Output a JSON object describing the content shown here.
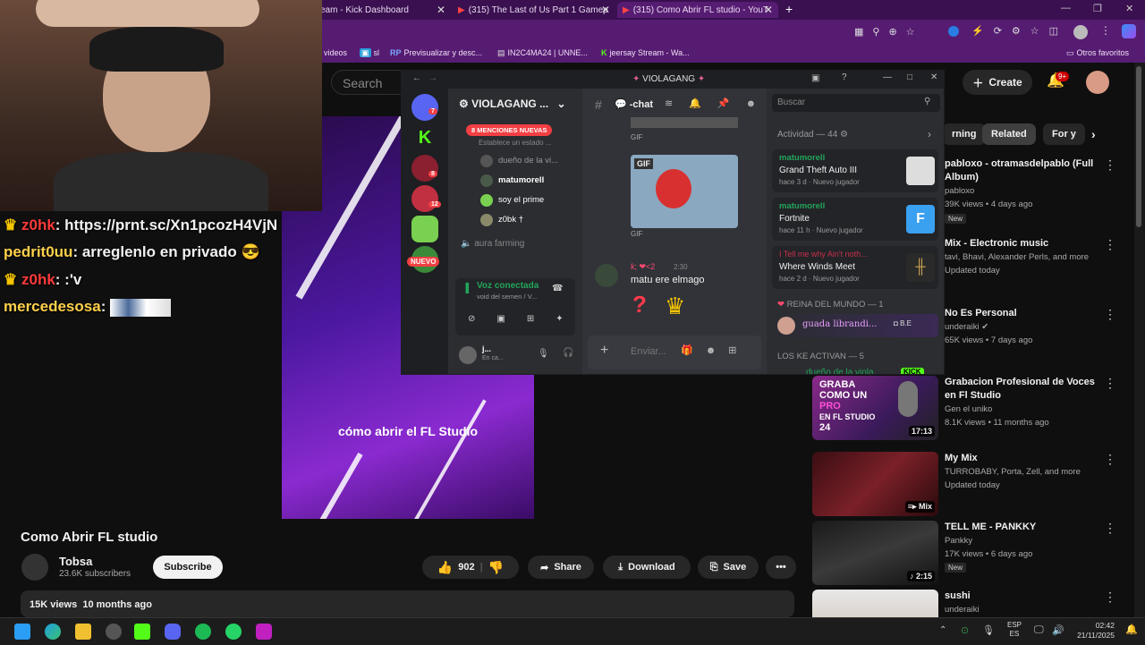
{
  "browser": {
    "tabs": [
      {
        "label": "eam - Kick Dashboard"
      },
      {
        "label": "(315) The Last of Us Part 1 Gamep"
      },
      {
        "label": "(315) Como Abrir FL studio - YouT"
      }
    ],
    "bookmarks": [
      "videos",
      "sl",
      "Previsualizar y desc...",
      "IN2C4MA24 | UNNE...",
      "jeersay Stream - Wa..."
    ],
    "bookmarks_other": "Otros favoritos"
  },
  "stream_chat": [
    {
      "user": "z0hk",
      "text": "https://prnt.sc/Xn1pcozH4VjN",
      "crown": true
    },
    {
      "user": "pedrit0uu",
      "text": "arreglenlo en privado",
      "crown": false
    },
    {
      "user": "z0hk",
      "text": ":'v",
      "crown": true
    },
    {
      "user": "mercedesosa",
      "text": "",
      "crown": false
    }
  ],
  "youtube": {
    "search_placeholder": "Search",
    "create_label": "Create",
    "notif_count": "9+",
    "video_caption": "cómo abrir el FL Studio",
    "video_title": "Como Abrir FL studio",
    "channel_name": "Tobsa",
    "subscribers": "23.6K subscribers",
    "subscribe_label": "Subscribe",
    "likes": "902",
    "share_label": "Share",
    "download_label": "Download",
    "save_label": "Save",
    "more_label": "•••",
    "views": "15K views",
    "age": "10 months ago",
    "chips": [
      "rning",
      "Related",
      "For y"
    ],
    "recommendations": [
      {
        "title": "pabloxo - otramasdelpablo (Full Album)",
        "channel": "pabloxo",
        "meta": "39K views • 4 days ago",
        "badge": "New",
        "duration": ""
      },
      {
        "title": "Mix - Electronic music",
        "channel": "tavi, Bhavi, Alexander Perls, and more",
        "meta": "Updated today",
        "badge": "",
        "duration": ""
      },
      {
        "title": "No Es Personal",
        "channel": "underaiki",
        "meta": "65K views • 7 days ago",
        "badge": "",
        "duration": ""
      },
      {
        "title": "Grabacion Profesional de Voces en Fl Studio",
        "channel": "Gen el uniko",
        "meta": "8.1K views • 11 months ago",
        "badge": "",
        "duration": "17:13"
      },
      {
        "title": "My Mix",
        "channel": "TURROBABY, Porta, Zell, and more",
        "meta": "Updated today",
        "badge": "",
        "duration": "Mix"
      },
      {
        "title": "TELL ME - PANKKY",
        "channel": "Pankky",
        "meta": "17K views • 6 days ago",
        "badge": "New",
        "duration": "2:15"
      },
      {
        "title": "sushi",
        "channel": "underaiki",
        "meta": "",
        "badge": "",
        "duration": ""
      }
    ],
    "thumb_overlay": [
      "GRABA",
      "COMO UN",
      "PRO",
      "EN FL STUDIO",
      "24"
    ]
  },
  "discord": {
    "window_title": "VIOLAGANG",
    "server_name": "VIOLAGANG ...",
    "channel_name": "-chat",
    "search_placeholder": "Buscar",
    "mentions_banner": "8 MENCIONES NUEVAS",
    "status_hint": "Establece un estado ...",
    "guild_badges": [
      "7",
      "8",
      "12"
    ],
    "guild_new": "NUEVO",
    "voice_users": [
      "dueño de la vi...",
      "matumorell",
      "soy el prime",
      "z0bk †"
    ],
    "voice_channel_2": "aura farming",
    "voice_connected": "Voz conectada",
    "voice_connected_sub": "void del semen / V...",
    "user_name": "j...",
    "user_status": "En ca...",
    "gif_label": "GIF",
    "msg_time": "2:30",
    "msg_text": "matu ere elmago",
    "input_placeholder": "Enviar...",
    "activity_header": "Actividad — 44",
    "activities": [
      {
        "user": "matumorell",
        "game": "Grand Theft Auto III",
        "time": "hace 3 d",
        "tag": "Nuevo jugador"
      },
      {
        "user": "matumorell",
        "game": "Fortnite",
        "time": "hace 11 h",
        "tag": "Nuevo jugador"
      },
      {
        "user": "I Tell me why Ain't noth...",
        "game": "Where Winds Meet",
        "time": "hace 2 d",
        "tag": "Nuevo jugador"
      }
    ],
    "role_1": "REINA DEL MUNDO — 1",
    "role_1_member": "guada librandi...",
    "role_1_tag": "B.E",
    "role_2": "LOS KE ACTIVAN — 5",
    "role_2_member": "dueño de la viola",
    "role_2_tag": "KICK"
  },
  "taskbar": {
    "lang_1": "ESP",
    "lang_2": "ES",
    "time": "02:42",
    "date": "21/11/2025"
  }
}
